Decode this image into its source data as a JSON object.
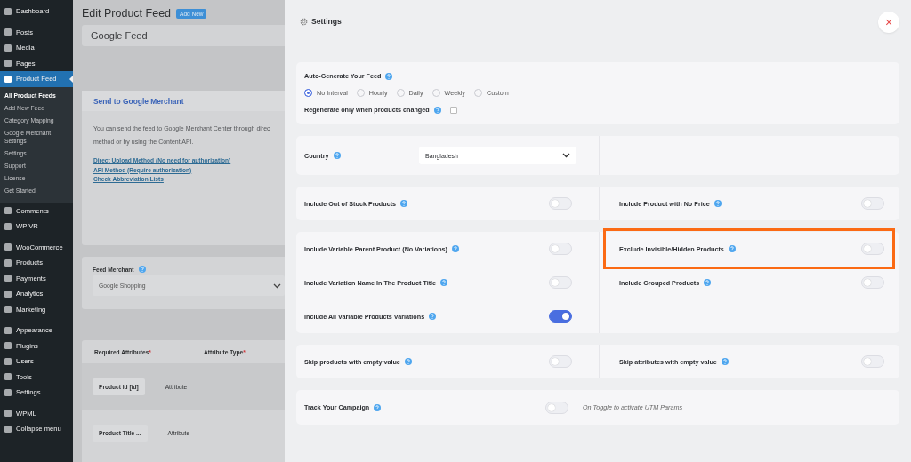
{
  "sidebar": {
    "groups": [
      {
        "items": [
          {
            "label": "Dashboard",
            "selected": false
          }
        ]
      },
      {
        "items": [
          {
            "label": "Posts",
            "selected": false
          },
          {
            "label": "Media",
            "selected": false
          },
          {
            "label": "Pages",
            "selected": false
          },
          {
            "label": "Product Feed",
            "selected": true,
            "children": [
              {
                "label": "All Product Feeds",
                "selected": true
              },
              {
                "label": "Add New Feed",
                "selected": false
              },
              {
                "label": "Category Mapping",
                "selected": false
              },
              {
                "label": "Google Merchant Settings",
                "selected": false
              },
              {
                "label": "Settings",
                "selected": false
              },
              {
                "label": "Support",
                "selected": false
              },
              {
                "label": "License",
                "selected": false
              },
              {
                "label": "Get Started",
                "selected": false
              }
            ]
          },
          {
            "label": "Comments",
            "selected": false
          },
          {
            "label": "WP VR",
            "selected": false
          }
        ]
      },
      {
        "items": [
          {
            "label": "WooCommerce",
            "selected": false
          },
          {
            "label": "Products",
            "selected": false
          },
          {
            "label": "Payments",
            "selected": false
          },
          {
            "label": "Analytics",
            "selected": false
          },
          {
            "label": "Marketing",
            "selected": false
          }
        ]
      },
      {
        "items": [
          {
            "label": "Appearance",
            "selected": false
          },
          {
            "label": "Plugins",
            "selected": false
          },
          {
            "label": "Users",
            "selected": false
          },
          {
            "label": "Tools",
            "selected": false
          },
          {
            "label": "Settings",
            "selected": false
          }
        ]
      },
      {
        "items": [
          {
            "label": "WPML",
            "selected": false
          },
          {
            "label": "Collapse menu",
            "selected": false
          }
        ]
      }
    ]
  },
  "page": {
    "title": "Edit Product Feed",
    "add_new": "Add New",
    "feed_name": "Google Feed",
    "merchant_card": {
      "title": "Send to Google Merchant",
      "text_lines": [
        "You can send the feed to Google Merchant Center through direc",
        "method or by using the Content API."
      ],
      "links": [
        "Direct Upload Method (No need for authorization)",
        "API Method (Require authorization)",
        "Check Abbreviation Lists"
      ]
    },
    "feed_merchant": {
      "label": "Feed Merchant",
      "value": "Google Shopping"
    },
    "attributes": {
      "columns": [
        {
          "label": "Required Attributes",
          "mark": "*"
        },
        {
          "label": "Attribute Type",
          "mark": "*"
        }
      ],
      "rows": [
        {
          "attribute": "Product Id [id]",
          "type": "Attribute"
        },
        {
          "attribute": "Product Title ...",
          "type": "Attribute"
        }
      ]
    }
  },
  "settings": {
    "title": "Settings",
    "close": "×",
    "cards": [
      {
        "kind": "schedule",
        "label": "Auto-Generate Your Feed",
        "options": [
          {
            "label": "No Interval",
            "selected": true
          },
          {
            "label": "Hourly",
            "selected": false
          },
          {
            "label": "Daily",
            "selected": false
          },
          {
            "label": "Weekly",
            "selected": false
          },
          {
            "label": "Custom",
            "selected": false
          }
        ],
        "regenerate": {
          "label": "Regenerate only when products changed",
          "checked": false
        }
      },
      {
        "kind": "select",
        "label": "Country",
        "value": "Bangladesh"
      },
      {
        "kind": "toggles",
        "left": [
          {
            "label": "Include Out of Stock Products",
            "on": false,
            "highlighted": false
          }
        ],
        "right": [
          {
            "label": "Include Product with No Price",
            "on": false,
            "highlighted": false
          }
        ]
      },
      {
        "kind": "toggles",
        "left": [
          {
            "label": "Include Variable Parent Product (No Variations)",
            "on": false,
            "highlighted": false
          },
          {
            "label": "Include Variation Name In The Product Title",
            "on": false,
            "highlighted": false
          },
          {
            "label": "Include All Variable Products Variations",
            "on": true,
            "highlighted": false
          }
        ],
        "right": [
          {
            "label": "Exclude Invisible/Hidden Products",
            "on": false,
            "highlighted": true
          },
          {
            "label": "Include Grouped Products",
            "on": false,
            "highlighted": false
          }
        ]
      },
      {
        "kind": "toggles",
        "left": [
          {
            "label": "Skip products with empty value",
            "on": false,
            "highlighted": false
          }
        ],
        "right": [
          {
            "label": "Skip attributes with empty value",
            "on": false,
            "highlighted": false
          }
        ]
      },
      {
        "kind": "campaign",
        "label": "Track Your Campaign",
        "on": false,
        "note": "On Toggle to activate UTM Params"
      }
    ]
  }
}
